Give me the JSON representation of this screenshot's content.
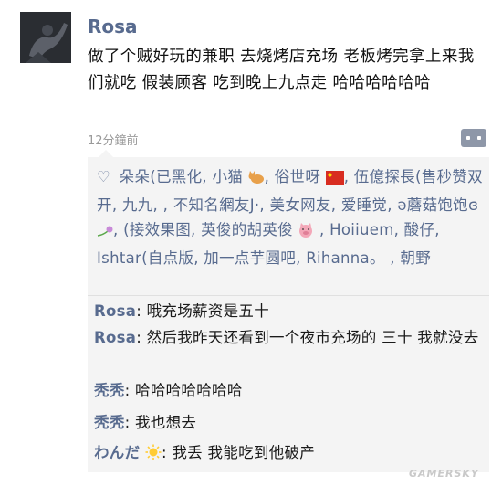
{
  "post": {
    "author": "Rosa",
    "text": "做了个贼好玩的兼职 去烧烤店充场 老板烤完拿上来我们就吃 假装顾客 吃到晚上九点走 哈哈哈哈哈哈",
    "time": "12分鐘前"
  },
  "likes": {
    "names": [
      "朵朵(已黑化",
      "小猫",
      "俗世呀",
      "伍億探長(售秒赞双开",
      "九九,",
      "不知名網友J·",
      "美女网友",
      "爱睡觉",
      "ə蘑菇饱饱ɞ",
      "(接效果图, 英俊的胡英俊",
      "Hoiiuem",
      "酸仔",
      "Ishtar(自点版, 加一点芋圆吧",
      "Rihanna。",
      "朝野"
    ]
  },
  "comments": [
    {
      "name": "Rosa",
      "text": "哦充场薪资是五十"
    },
    {
      "name": "Rosa",
      "text": "然后我昨天还看到一个夜市充场的 三十 我就没去"
    },
    {
      "name": "秃秃",
      "text": "哈哈哈哈哈哈哈"
    },
    {
      "name": "秃秃",
      "text": "我也想去"
    },
    {
      "name": "わんだ",
      "text": "我丢 我能吃到他破产"
    }
  ],
  "watermark": "GAMERSKY",
  "icons": [
    "heart-icon",
    "cat-emoji-icon",
    "china-flag-icon",
    "flower-emoji-icon",
    "pig-emoji-icon",
    "sun-emoji-icon",
    "comment-icon"
  ],
  "colors": {
    "name_blue": "#586b8f",
    "panel_bg": "#f4f4f4",
    "time_gray": "#9a9a9a"
  }
}
